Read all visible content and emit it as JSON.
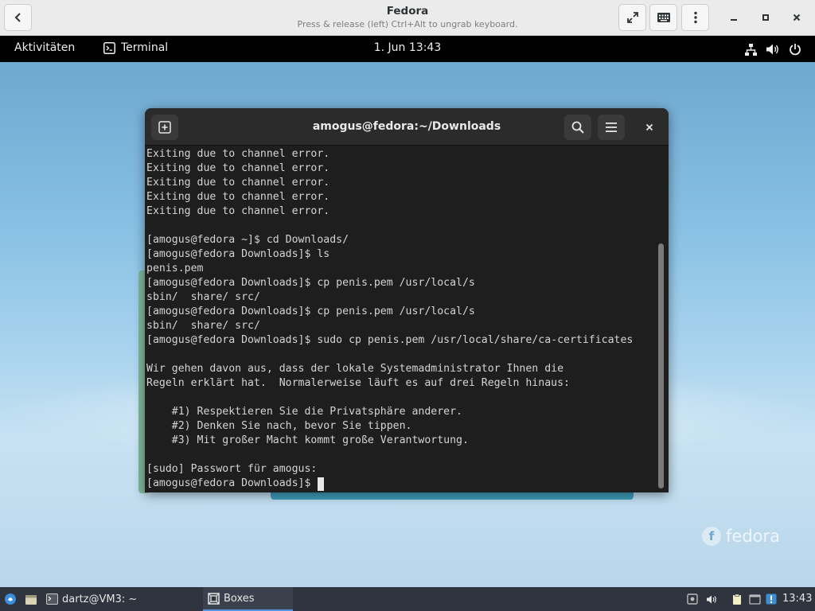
{
  "host_window": {
    "title": "Fedora",
    "subtitle": "Press & release (left) Ctrl+Alt to ungrab keyboard."
  },
  "guest_topbar": {
    "activities": "Aktivitäten",
    "app_name": "Terminal",
    "clock": "1. Jun  13:43"
  },
  "terminal": {
    "title": "amogus@fedora:~/Downloads",
    "lines": [
      "Exiting due to channel error.",
      "Exiting due to channel error.",
      "Exiting due to channel error.",
      "Exiting due to channel error.",
      "Exiting due to channel error.",
      "",
      "[amogus@fedora ~]$ cd Downloads/",
      "[amogus@fedora Downloads]$ ls",
      "penis.pem",
      "[amogus@fedora Downloads]$ cp penis.pem /usr/local/s",
      "sbin/  share/ src/",
      "[amogus@fedora Downloads]$ cp penis.pem /usr/local/s",
      "sbin/  share/ src/",
      "[amogus@fedora Downloads]$ sudo cp penis.pem /usr/local/share/ca-certificates",
      "",
      "Wir gehen davon aus, dass der lokale Systemadministrator Ihnen die",
      "Regeln erklärt hat.  Normalerweise läuft es auf drei Regeln hinaus:",
      "",
      "    #1) Respektieren Sie die Privatsphäre anderer.",
      "    #2) Denken Sie nach, bevor Sie tippen.",
      "    #3) Mit großer Macht kommt große Verantwortung.",
      "",
      "[sudo] Passwort für amogus:"
    ],
    "prompt": "[amogus@fedora Downloads]$ "
  },
  "desktop": {
    "logo_text": "fedora"
  },
  "taskbar": {
    "terminal_task": "dartz@VM3: ~",
    "boxes_task": "Boxes",
    "clock": "13:43"
  },
  "colors": {
    "terminal_bg": "#1e1e1e",
    "terminal_header": "#2b2b2b",
    "taskbar_bg": "#2f343f",
    "accent": "#5294e2"
  }
}
